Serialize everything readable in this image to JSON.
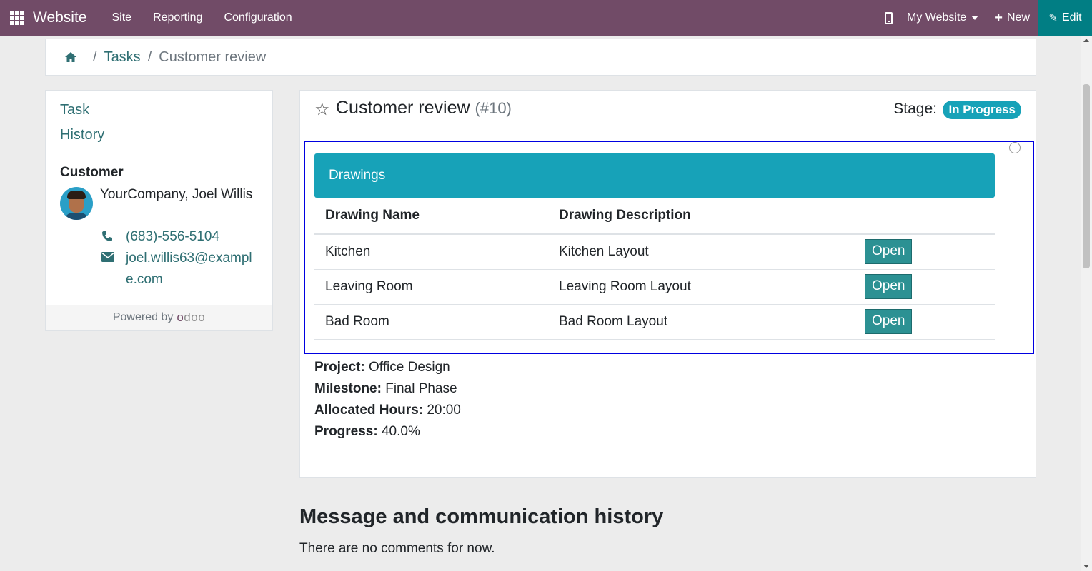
{
  "navbar": {
    "brand": "Website",
    "menu": [
      "Site",
      "Reporting",
      "Configuration"
    ],
    "website_selector": "My Website",
    "new_label": "New",
    "edit_label": "Edit",
    "color": "#714b67",
    "edit_color": "#017e84"
  },
  "breadcrumb": {
    "items": [
      "Tasks",
      "Customer review"
    ]
  },
  "sidebar": {
    "links": [
      "Task",
      "History"
    ],
    "customer_title": "Customer",
    "customer_name": "YourCompany, Joel Willis",
    "phone": "(683)-556-5104",
    "email": "joel.willis63@example.com",
    "powered_by": "Powered by"
  },
  "task": {
    "title": "Customer review",
    "ref": "(#10)",
    "stage_label": "Stage:",
    "stage": "In Progress",
    "stage_color": "#17a2b8"
  },
  "drawings": {
    "heading": "Drawings",
    "columns": [
      "Drawing Name",
      "Drawing Description"
    ],
    "rows": [
      {
        "name": "Kitchen",
        "description": "Kitchen Layout",
        "action": "Open"
      },
      {
        "name": "Leaving Room",
        "description": "Leaving Room Layout",
        "action": "Open"
      },
      {
        "name": "Bad Room",
        "description": "Bad Room Layout",
        "action": "Open"
      }
    ]
  },
  "details": {
    "project_label": "Project:",
    "project": "Office Design",
    "milestone_label": "Milestone:",
    "milestone": "Final Phase",
    "hours_label": "Allocated Hours:",
    "hours": "20:00",
    "progress_label": "Progress:",
    "progress": "40.0%"
  },
  "history": {
    "title": "Message and communication history",
    "empty": "There are no comments for now."
  }
}
